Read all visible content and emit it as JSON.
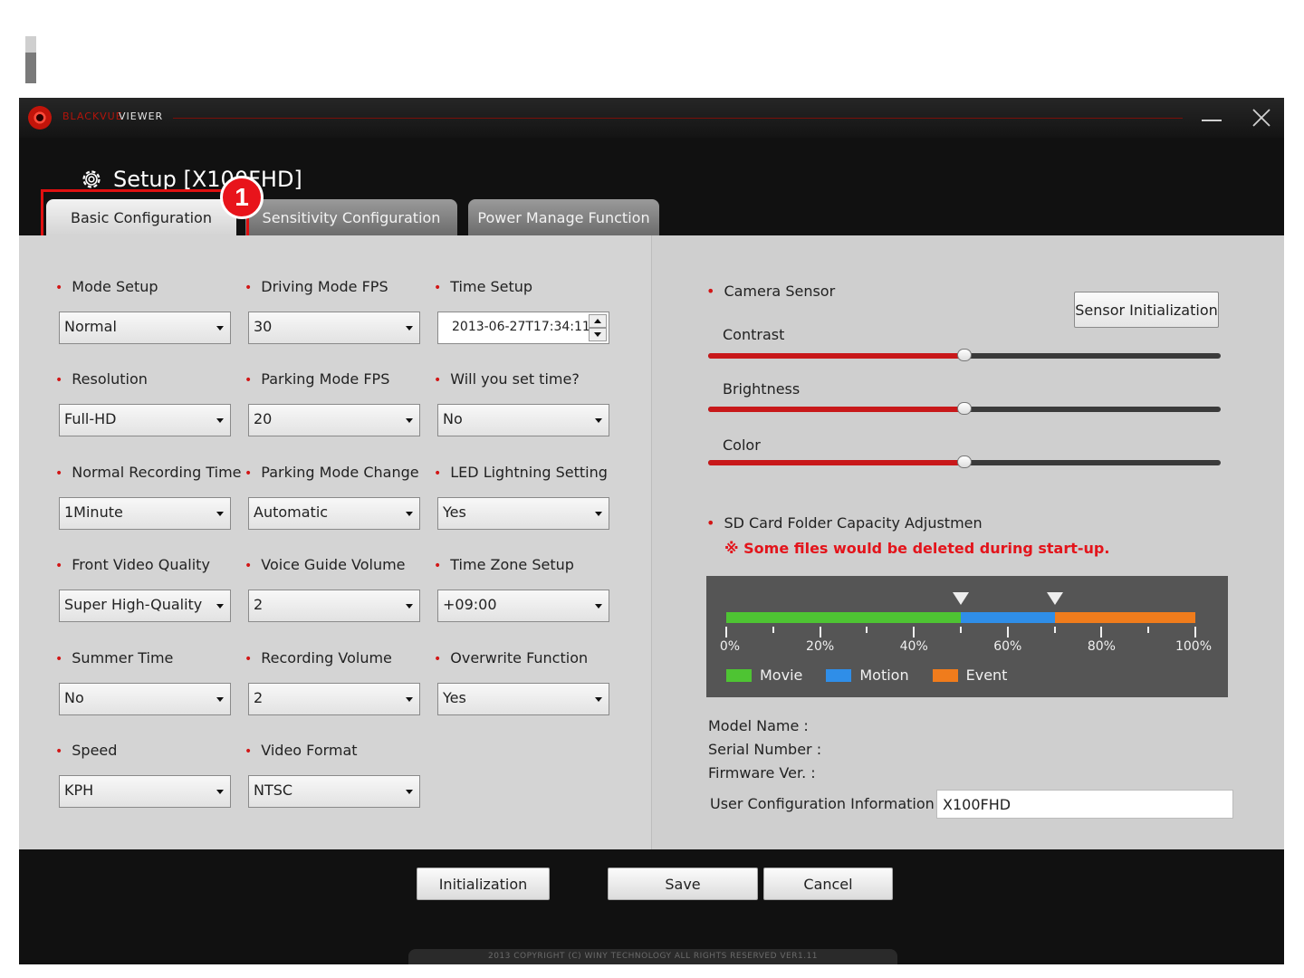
{
  "app": {
    "brand": "BLACKVUE",
    "viewer": "VIEWER",
    "setup_title": "Setup [X100FHD]",
    "copyright": "2013 COPYRIGHT (C) WINY TECHNOLOGY ALL RIGHTS RESERVED VER1.11"
  },
  "callout": {
    "number": "1"
  },
  "tabs": [
    {
      "label": "Basic Configuration",
      "active": true
    },
    {
      "label": "Sensitivity Configuration",
      "active": false
    },
    {
      "label": "Power Manage Function",
      "active": false
    }
  ],
  "basic": {
    "mode_setup": {
      "label": "Mode Setup",
      "value": "Normal"
    },
    "driving_fps": {
      "label": "Driving Mode FPS",
      "value": "30"
    },
    "time_setup": {
      "label": "Time Setup",
      "value": "2013-06-27T17:34:11"
    },
    "resolution": {
      "label": "Resolution",
      "value": "Full-HD"
    },
    "parking_fps": {
      "label": "Parking Mode FPS",
      "value": "20"
    },
    "set_time": {
      "label": "Will you set time?",
      "value": "No"
    },
    "normal_rec_time": {
      "label": "Normal Recording Time",
      "value": "1Minute"
    },
    "parking_change": {
      "label": "Parking Mode Change",
      "value": "Automatic"
    },
    "led_setting": {
      "label": "LED Lightning Setting",
      "value": "Yes"
    },
    "front_quality": {
      "label": "Front Video Quality",
      "value": "Super High-Quality"
    },
    "voice_volume": {
      "label": "Voice Guide Volume",
      "value": "2"
    },
    "timezone": {
      "label": "Time Zone Setup",
      "value": "+09:00"
    },
    "summer_time": {
      "label": "Summer Time",
      "value": "No"
    },
    "rec_volume": {
      "label": "Recording Volume",
      "value": "2"
    },
    "overwrite": {
      "label": "Overwrite Function",
      "value": "Yes"
    },
    "speed": {
      "label": "Speed",
      "value": "KPH"
    },
    "video_format": {
      "label": "Video Format",
      "value": "NTSC"
    }
  },
  "sensor": {
    "label": "Camera Sensor",
    "init_button": "Sensor Initialization",
    "contrast": {
      "label": "Contrast",
      "level": 0.5
    },
    "brightness": {
      "label": "Brightness",
      "level": 0.5
    },
    "color": {
      "label": "Color",
      "level": 0.5
    }
  },
  "sd": {
    "label": "SD Card Folder Capacity Adjustmen",
    "warning": "※ Some files would be deleted during start-up.",
    "movie_pct": 50,
    "motion_pct": 20,
    "event_pct": 30,
    "ticks": [
      "0%",
      "20%",
      "40%",
      "60%",
      "80%",
      "100%"
    ],
    "legend": [
      {
        "name": "Movie",
        "color": "#4ec433"
      },
      {
        "name": "Motion",
        "color": "#2f8ee8"
      },
      {
        "name": "Event",
        "color": "#f07c1c"
      }
    ]
  },
  "info": {
    "model_name": "Model Name :",
    "serial_number": "Serial Number :",
    "firmware": "Firmware Ver. :",
    "user_config_label": "User Configuration Information",
    "user_config_value": "X100FHD"
  },
  "buttons": {
    "initialization": "Initialization",
    "save": "Save",
    "cancel": "Cancel"
  }
}
